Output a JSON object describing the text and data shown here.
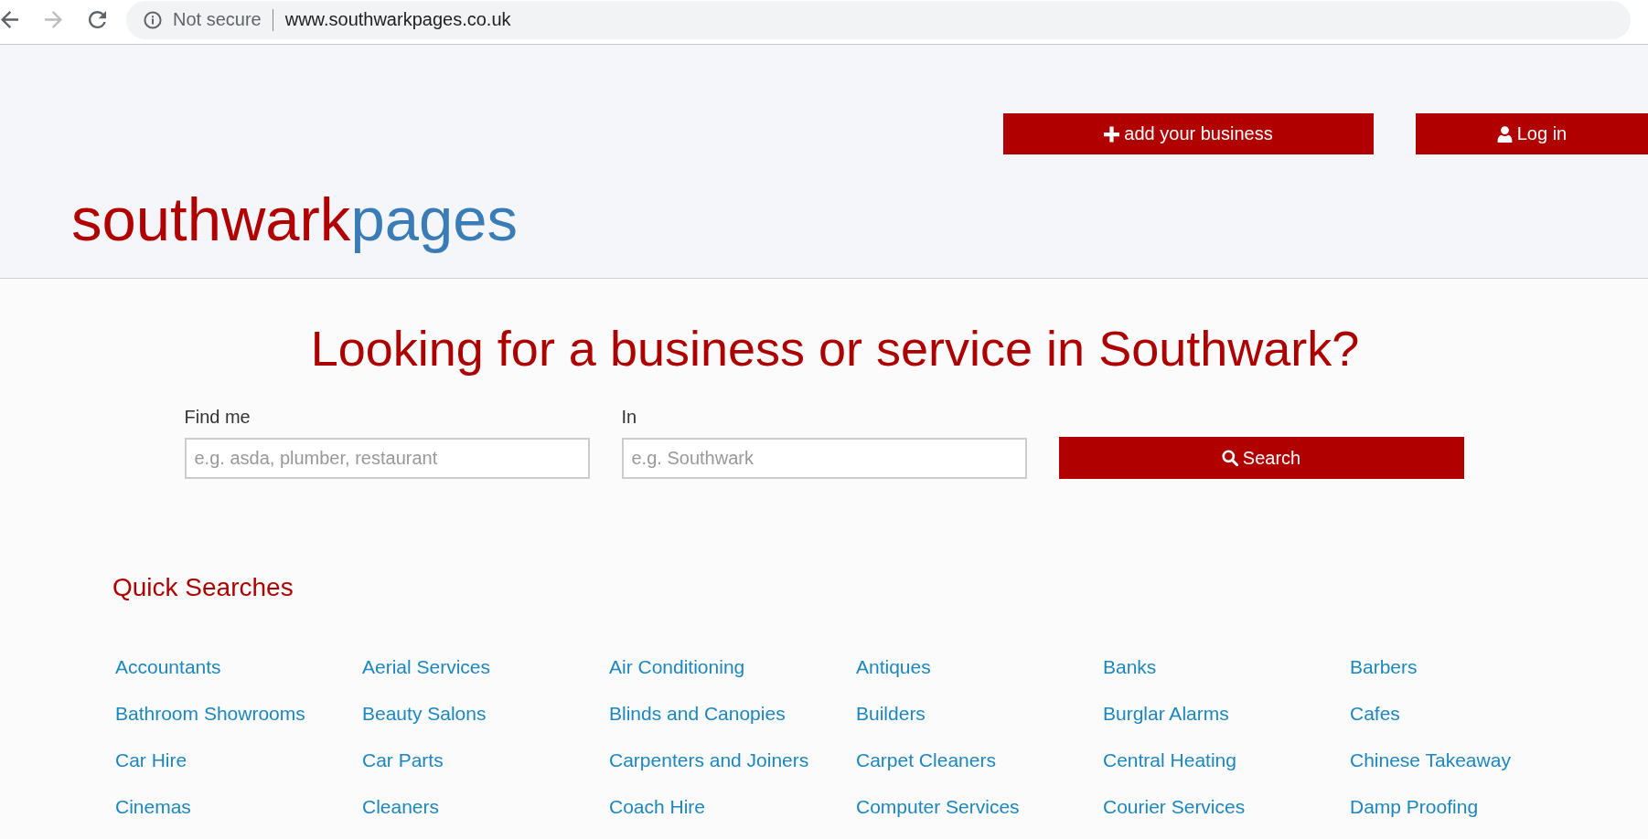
{
  "browser": {
    "nav": [
      {
        "kind": "back",
        "disabled": false
      },
      {
        "kind": "forward",
        "disabled": true
      },
      {
        "kind": "reload",
        "disabled": false
      }
    ],
    "address": {
      "security": "Not secure",
      "url": "www.southwarkpages.co.uk"
    }
  },
  "header": {
    "buttons": [
      {
        "kind": "add",
        "label": "add your business"
      },
      {
        "kind": "login",
        "label": "Log in"
      }
    ],
    "logo": [
      "southwark",
      "pages"
    ]
  },
  "hero": {
    "heading": "Looking for a business or service in Southwark?",
    "fields": [
      {
        "label": "Find me",
        "placeholder": "e.g. asda, plumber, restaurant"
      },
      {
        "label": "In",
        "placeholder": "e.g. Southwark"
      }
    ],
    "search_button": "Search"
  },
  "quick_searches": {
    "title": "Quick Searches",
    "items": [
      "Accountants",
      "Aerial Services",
      "Air Conditioning",
      "Antiques",
      "Banks",
      "Barbers",
      "Bathroom Showrooms",
      "Beauty Salons",
      "Blinds and Canopies",
      "Builders",
      "Burglar Alarms",
      "Cafes",
      "Car Hire",
      "Car Parts",
      "Carpenters and Joiners",
      "Carpet Cleaners",
      "Central Heating",
      "Chinese Takeaway",
      "Cinemas",
      "Cleaners",
      "Coach Hire",
      "Computer Services",
      "Courier Services",
      "Damp Proofing"
    ]
  }
}
